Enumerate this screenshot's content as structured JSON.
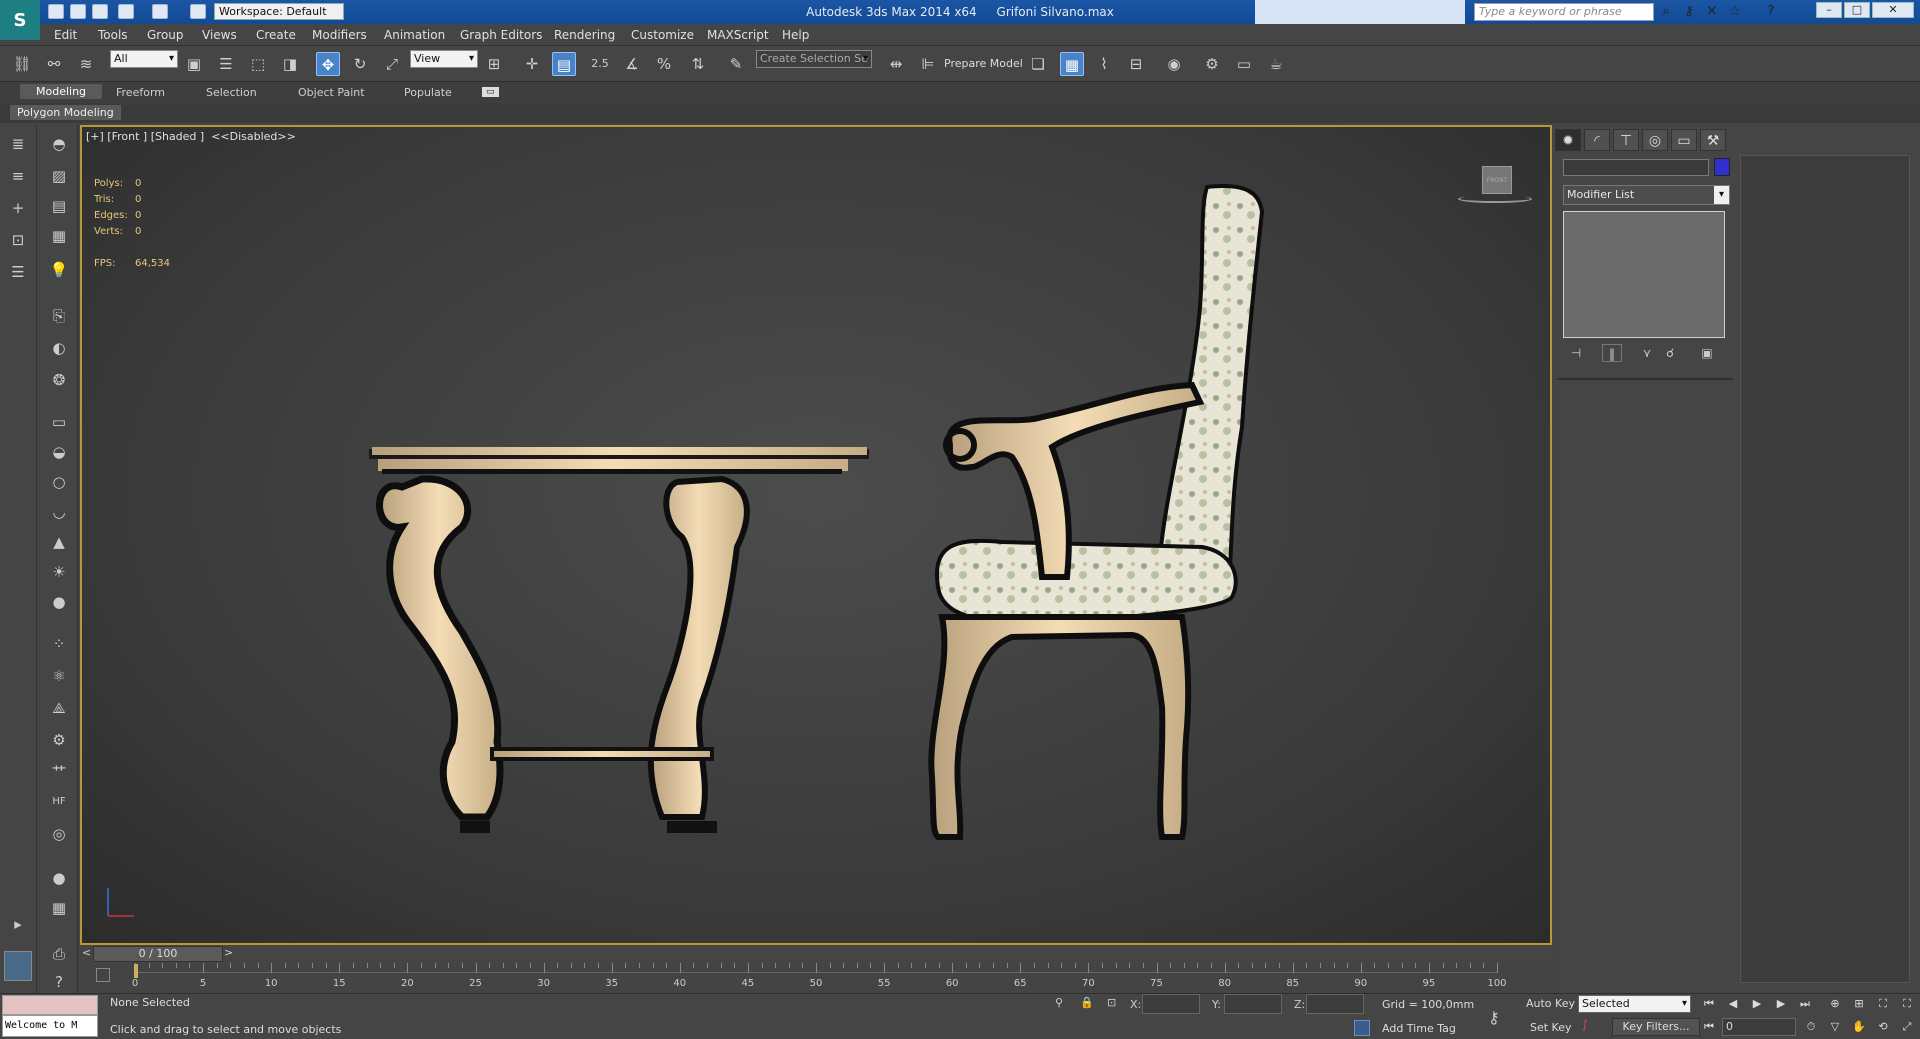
{
  "app": {
    "title": "Autodesk 3ds Max  2014 x64",
    "file": "Grifoni Silvano.max",
    "workspace": "Workspace: Default",
    "search_placeholder": "Type a keyword or phrase"
  },
  "menu": [
    "Edit",
    "Tools",
    "Group",
    "Views",
    "Create",
    "Modifiers",
    "Animation",
    "Graph Editors",
    "Rendering",
    "Customize",
    "MAXScript",
    "Help"
  ],
  "toolbar": {
    "filter": "All",
    "coord": "View",
    "snap_value": "2.5",
    "named_selection": "Create Selection Se",
    "prepare_model": "Prepare Model"
  },
  "ribbon": {
    "tabs": [
      "Modeling",
      "Freeform",
      "Selection",
      "Object Paint",
      "Populate"
    ],
    "active_tab": "Modeling",
    "panel": "Polygon Modeling"
  },
  "viewport": {
    "label": "[+] [Front ] [Shaded ]  <<Disabled>>",
    "stats": {
      "polys": "0",
      "tris": "0",
      "edges": "0",
      "verts": "0",
      "fps": "64,534"
    },
    "stat_labels": {
      "polys": "Polys:",
      "tris": "Tris:",
      "edges": "Edges:",
      "verts": "Verts:",
      "fps": "FPS:"
    },
    "viewcube_label": "FRONT"
  },
  "command_panel": {
    "modifier_list": "Modifier List",
    "color": "#3030d0"
  },
  "timeline": {
    "position": "0 / 100",
    "ticks": [
      "0",
      "5",
      "10",
      "15",
      "20",
      "25",
      "30",
      "35",
      "40",
      "45",
      "50",
      "55",
      "60",
      "65",
      "70",
      "75",
      "80",
      "85",
      "90",
      "95",
      "100"
    ]
  },
  "status": {
    "selection": "None Selected",
    "prompt": "Click and drag to select and move objects",
    "welcome": "Welcome to M",
    "x_label": "X:",
    "y_label": "Y:",
    "z_label": "Z:",
    "grid": "Grid = 100,0mm",
    "add_time_tag": "Add Time Tag",
    "auto_key": "Auto Key",
    "set_key": "Set Key",
    "key_mode": "Selected",
    "key_filters": "Key Filters...",
    "frame": "0"
  }
}
